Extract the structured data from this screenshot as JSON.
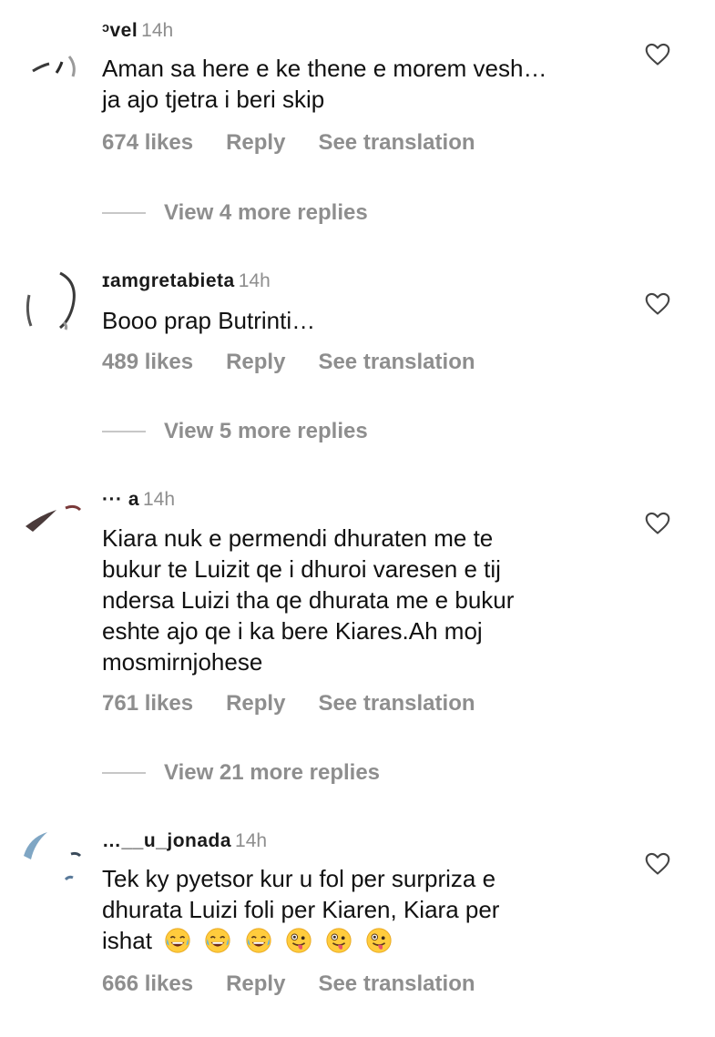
{
  "comments": [
    {
      "username": "ᵓvel",
      "time": "14h",
      "lines": [
        "Aman sa here e ke thene e morem vesh…",
        "ja ajo tjetra i beri skip"
      ],
      "likes": "674 likes",
      "reply": "Reply",
      "translate": "See translation",
      "view_replies": "View 4 more replies"
    },
    {
      "username": "ɪamgretabieta",
      "time": "14h",
      "lines": [
        "Booo prap Butrinti…"
      ],
      "likes": "489 likes",
      "reply": "Reply",
      "translate": "See translation",
      "view_replies": "View 5 more replies"
    },
    {
      "username": "··· a",
      "time": "14h",
      "lines": [
        "Kiara nuk e permendi dhuraten me te",
        "bukur te Luizit qe i dhuroi varesen e tij",
        "ndersa Luizi tha qe dhurata me  e bukur",
        "eshte ajo qe i ka bere Kiares.Ah moj",
        "mosmirnjohese"
      ],
      "likes": "761 likes",
      "reply": "Reply",
      "translate": "See translation",
      "view_replies": "View 21 more replies"
    },
    {
      "username": "…__u_jonada",
      "time": "14h",
      "lines": [
        "Tek ky pyetsor kur u fol per surpriza e",
        "dhurata Luizi foli per Kiaren, Kiara per",
        "ishat"
      ],
      "emojis": [
        "joy-emoji",
        "joy-emoji",
        "joy-emoji",
        "zany-emoji",
        "zany-emoji",
        "zany-emoji"
      ],
      "likes": "666 likes",
      "reply": "Reply",
      "translate": "See translation"
    }
  ],
  "icons": {
    "like": "heart-outline-icon"
  },
  "colors": {
    "text": "#111111",
    "muted": "#8e8e8e",
    "emoji_yellow": "#FFCC3D"
  }
}
